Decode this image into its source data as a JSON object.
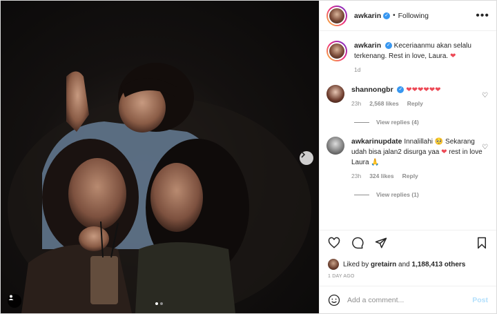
{
  "post": {
    "author": "awkarin",
    "separator": "•",
    "follow_status": "Following",
    "more_label": "•••",
    "caption": "Keceriaanmu akan selalu terkenang. Rest in love, Laura.",
    "caption_emoji": "❤",
    "caption_age": "1d"
  },
  "comments": [
    {
      "user": "shannongbr",
      "verified": true,
      "text": "",
      "emoji": "❤❤❤❤❤❤",
      "age": "23h",
      "likes": "2,568 likes",
      "reply": "Reply",
      "view_replies": "View replies (4)"
    },
    {
      "user": "awkarinupdate",
      "verified": false,
      "text_1": "Innalillahi",
      "emoji_1": "🥺",
      "text_2": "Sekarang udah bisa jalan2 disurga yaa",
      "emoji_2": "❤",
      "text_3": "rest in love Laura",
      "emoji_3": "🙏",
      "age": "23h",
      "likes": "324 likes",
      "reply": "Reply",
      "view_replies": "View replies (1)"
    }
  ],
  "likes": {
    "prefix": "Liked by",
    "user": "gretairn",
    "mid": "and",
    "count": "1,188,413 others"
  },
  "time_ago": "1 DAY AGO",
  "add_comment": {
    "placeholder": "Add a comment...",
    "post_label": "Post"
  },
  "colors": {
    "verified": "#3897f0",
    "heart_red": "#ed4956",
    "post_disabled": "#b2dffc"
  },
  "icons": [
    "next-arrow-icon",
    "tag-user-icon",
    "heart-icon",
    "comment-icon",
    "share-icon",
    "bookmark-icon",
    "smiley-icon"
  ]
}
